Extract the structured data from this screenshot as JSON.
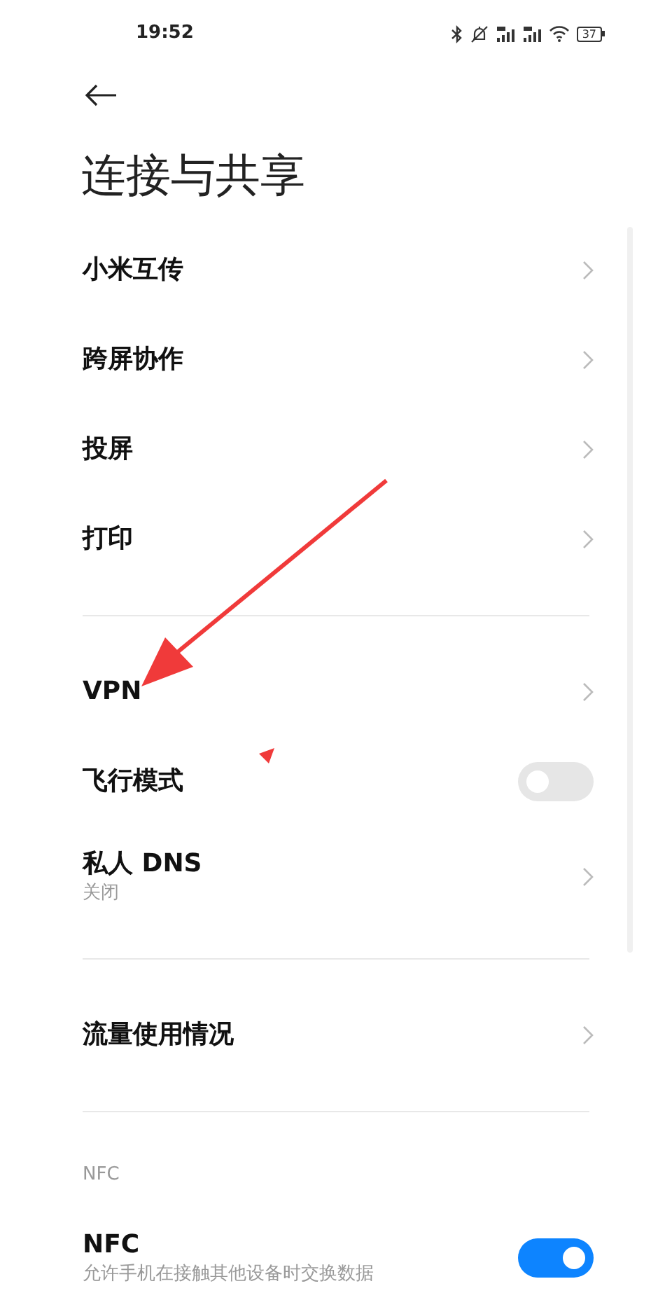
{
  "status_bar": {
    "time": "19:52",
    "battery": "37"
  },
  "title": "连接与共享",
  "sections": [
    {
      "items": [
        {
          "kind": "link",
          "label": "小米互传"
        },
        {
          "kind": "link",
          "label": "跨屏协作"
        },
        {
          "kind": "link",
          "label": "投屏"
        },
        {
          "kind": "link",
          "label": "打印"
        }
      ]
    },
    {
      "items": [
        {
          "kind": "link",
          "label": "VPN"
        },
        {
          "kind": "toggle",
          "label": "飞行模式",
          "on": false
        },
        {
          "kind": "link",
          "label": "私人 DNS",
          "subtitle": "关闭"
        }
      ]
    },
    {
      "items": [
        {
          "kind": "link",
          "label": "流量使用情况"
        }
      ]
    },
    {
      "header": "NFC",
      "items": [
        {
          "kind": "toggle",
          "label": "NFC",
          "subtitle": "允许手机在接触其他设备时交换数据",
          "on": true
        }
      ]
    }
  ]
}
